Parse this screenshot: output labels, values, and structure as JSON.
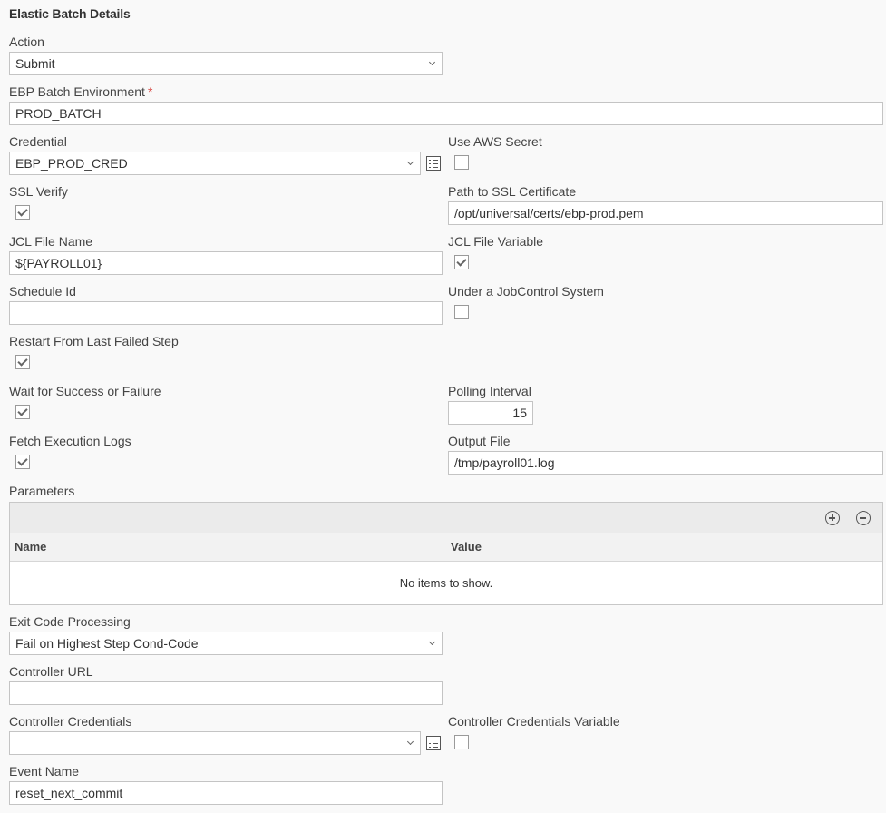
{
  "section_title": "Elastic Batch Details",
  "action": {
    "label": "Action",
    "value": "Submit"
  },
  "ebp_env": {
    "label": "EBP Batch Environment",
    "required_mark": "*",
    "value": "PROD_BATCH"
  },
  "credential": {
    "label": "Credential",
    "value": "EBP_PROD_CRED"
  },
  "use_aws_secret": {
    "label": "Use AWS Secret",
    "checked": false
  },
  "ssl_verify": {
    "label": "SSL Verify",
    "checked": true
  },
  "ssl_cert_path": {
    "label": "Path to SSL Certificate",
    "value": "/opt/universal/certs/ebp-prod.pem"
  },
  "jcl_file_name": {
    "label": "JCL File Name",
    "value": "${PAYROLL01}"
  },
  "jcl_file_variable": {
    "label": "JCL File Variable",
    "checked": true
  },
  "schedule_id": {
    "label": "Schedule Id",
    "value": ""
  },
  "jobcontrol": {
    "label": "Under a JobControl System",
    "checked": false
  },
  "restart": {
    "label": "Restart From Last Failed Step",
    "checked": true
  },
  "wait": {
    "label": "Wait for Success or Failure",
    "checked": true
  },
  "polling": {
    "label": "Polling Interval",
    "value": "15"
  },
  "fetch_logs": {
    "label": "Fetch Execution Logs",
    "checked": true
  },
  "output_file": {
    "label": "Output File",
    "value": "/tmp/payroll01.log"
  },
  "parameters": {
    "label": "Parameters",
    "columns": [
      "Name",
      "Value"
    ],
    "empty_text": "No items to show."
  },
  "exit_code": {
    "label": "Exit Code Processing",
    "value": "Fail on Highest Step Cond-Code"
  },
  "controller_url": {
    "label": "Controller URL",
    "value": ""
  },
  "controller_creds": {
    "label": "Controller Credentials",
    "value": ""
  },
  "controller_creds_var": {
    "label": "Controller Credentials Variable",
    "checked": false
  },
  "event_name": {
    "label": "Event Name",
    "value": "reset_next_commit"
  }
}
